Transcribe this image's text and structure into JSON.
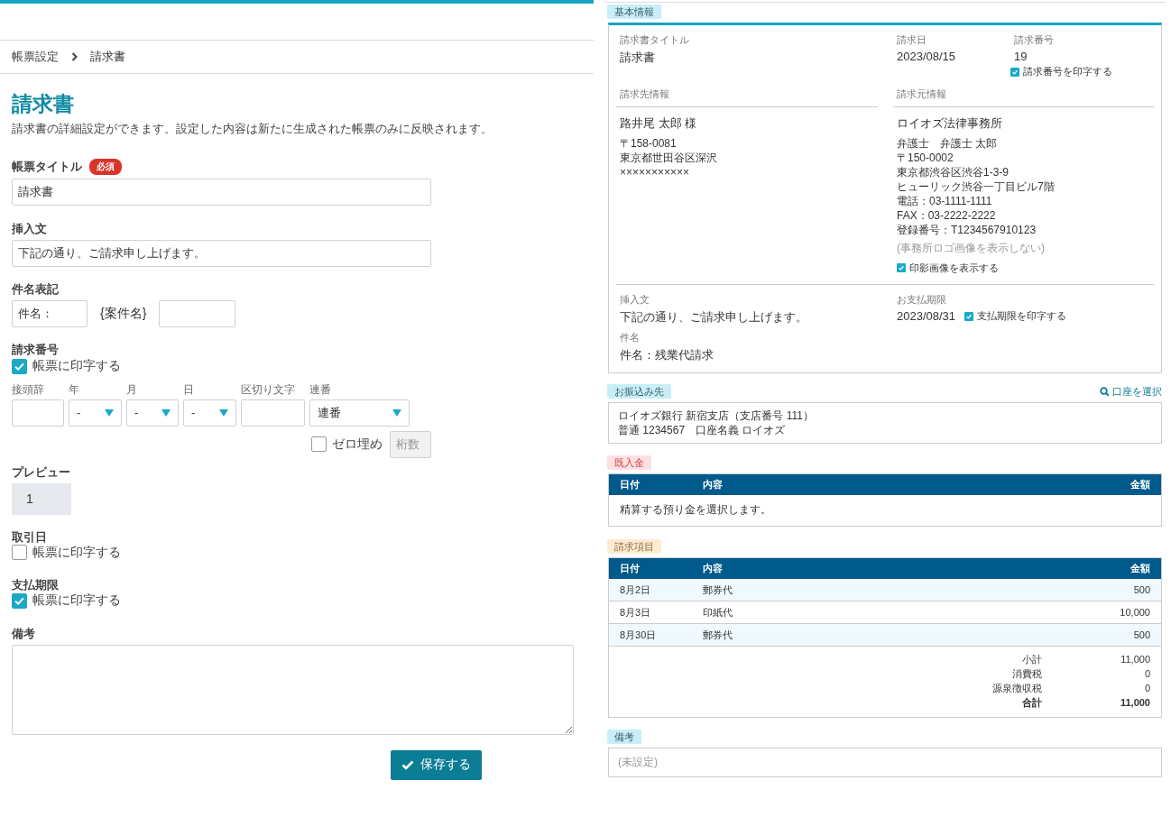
{
  "breadcrumb": [
    {
      "label": "帳票設定",
      "kind": "link"
    },
    {
      "label": "請求書",
      "kind": "current"
    }
  ],
  "page": {
    "title": "請求書",
    "description": "請求書の詳細設定ができます。設定した内容は新たに生成された帳票のみに反映されます。"
  },
  "form": {
    "title_field": {
      "label": "帳票タイトル",
      "badge": "必須",
      "value": "請求書"
    },
    "insert_text": {
      "label": "挿入文",
      "value": "下記の通り、ご請求申し上げます。"
    },
    "subject": {
      "label": "件名表記",
      "prefix_value": "件名：",
      "middle_text": "{案件名}"
    },
    "invoice_number": {
      "label": "請求番号",
      "print": {
        "label": "帳票に印字する",
        "checked": true
      },
      "parts": [
        {
          "kind": "input",
          "label": "接頭辞"
        },
        {
          "kind": "select",
          "label": "年",
          "value": "-"
        },
        {
          "kind": "select",
          "label": "月",
          "value": "-"
        },
        {
          "kind": "select",
          "label": "日",
          "value": "-"
        },
        {
          "kind": "input",
          "label": "区切り文字"
        },
        {
          "kind": "select",
          "label": "連番",
          "value": "連番"
        }
      ],
      "zero_pad": {
        "label": "ゼロ埋め",
        "checked": false
      },
      "digits": {
        "placeholder": "桁数",
        "disabled": true
      }
    },
    "preview": {
      "label": "プレビュー",
      "value": "1"
    },
    "transaction_date": {
      "label": "取引日",
      "print": {
        "label": "帳票に印字する",
        "checked": false
      }
    },
    "due_date": {
      "label": "支払期限",
      "print": {
        "label": "帳票に印字する",
        "checked": true
      }
    },
    "notes": {
      "label": "備考"
    },
    "save_button": "保存する"
  },
  "invoice_preview": {
    "basic": {
      "tag": "基本情報",
      "color": "#c9eef7",
      "title_label": "請求書タイトル",
      "title": "請求書",
      "date_label": "請求日",
      "date": "2023/08/15",
      "number_label": "請求番号",
      "number": "19",
      "number_print": {
        "label": "請求番号を印字する",
        "checked": true
      },
      "recipient": {
        "label": "請求先情報",
        "name": "路井尾 太郎 様",
        "lines": [
          "〒158-0081",
          "東京都世田谷区深沢",
          "×××××××××××"
        ]
      },
      "sender": {
        "label": "請求元情報",
        "name": "ロイオズ法律事務所",
        "lines": [
          "弁護士　弁護士 太郎",
          "〒150-0002",
          "東京都渋谷区渋谷1-3-9",
          "ヒューリック渋谷一丁目ビル7階",
          "電話：03-1111-1111",
          "FAX：03-2222-2222",
          "登録番号：T1234567910123"
        ],
        "logo_note": "(事務所ロゴ画像を表示しない)",
        "seal": {
          "label": "印影画像を表示する",
          "checked": true
        }
      },
      "insert_label": "挿入文",
      "insert": "下記の通り、ご請求申し上げます。",
      "due_label": "お支払期限",
      "due": "2023/08/31",
      "due_print": {
        "label": "支払期限を印字する",
        "checked": true
      },
      "subject_label": "件名",
      "subject": "件名：残業代請求"
    },
    "bank": {
      "tag": "お振込み先",
      "color": "#c9eef7",
      "select_link": "口座を選択",
      "lines": [
        "ロイオズ銀行 新宿支店（支店番号 111）",
        "普通 1234567　口座名義 ロイオズ"
      ]
    },
    "deposits": {
      "tag": "既入金",
      "color": "#fde0e2",
      "columns": [
        "日付",
        "内容",
        "金額"
      ],
      "empty": "精算する預り金を選択します。"
    },
    "items": {
      "tag": "請求項目",
      "color": "#fdebd3",
      "columns": [
        "日付",
        "内容",
        "金額"
      ],
      "rows": [
        {
          "date": "8月2日",
          "description": "郵券代",
          "amount": "500"
        },
        {
          "date": "8月3日",
          "description": "印紙代",
          "amount": "10,000"
        },
        {
          "date": "8月30日",
          "description": "郵券代",
          "amount": "500"
        }
      ],
      "totals": [
        {
          "label": "小計",
          "value": "11,000",
          "kind": "normal"
        },
        {
          "label": "消費税",
          "value": "0",
          "kind": "normal"
        },
        {
          "label": "源泉徴収税",
          "value": "0",
          "kind": "normal"
        },
        {
          "label": "合計",
          "value": "11,000",
          "kind": "total"
        }
      ]
    },
    "remarks": {
      "tag": "備考",
      "color": "#c9eef7",
      "value": "(未設定)"
    }
  }
}
